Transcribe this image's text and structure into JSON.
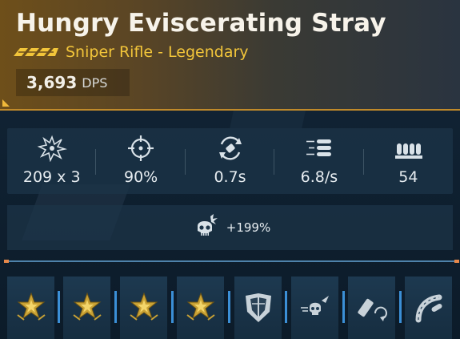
{
  "item": {
    "name": "Hungry Eviscerating Stray",
    "subtitle": "Sniper Rifle - Legendary",
    "rarity_icon": "legendary-chevrons-icon",
    "dps_value": "3,693",
    "dps_unit": "DPS"
  },
  "stats": [
    {
      "icon": "damage-burst-icon",
      "value": "209 x 3"
    },
    {
      "icon": "crosshair-icon",
      "value": "90%"
    },
    {
      "icon": "reload-icon",
      "value": "0.7s"
    },
    {
      "icon": "fire-rate-icon",
      "value": "6.8/s"
    },
    {
      "icon": "ammo-icon",
      "value": "54"
    }
  ],
  "perk": {
    "icon": "skull-damage-icon",
    "value": "+199%"
  },
  "slots": [
    {
      "icon": "gold-star-badge-icon"
    },
    {
      "icon": "gold-star-badge-icon"
    },
    {
      "icon": "gold-star-badge-icon"
    },
    {
      "icon": "gold-star-badge-icon"
    },
    {
      "icon": "armor-plate-icon"
    },
    {
      "icon": "skull-projectile-icon"
    },
    {
      "icon": "magazine-reload-icon"
    },
    {
      "icon": "curved-magazine-icon"
    }
  ],
  "colors": {
    "legendary": "#f2c53a",
    "accent_blue": "#3b8fd6",
    "header_gold": "#6e4f1a"
  }
}
